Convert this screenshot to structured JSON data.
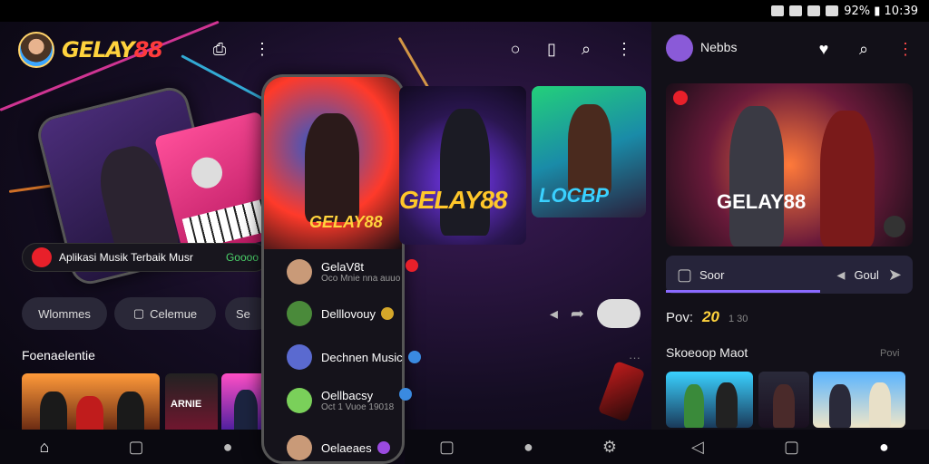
{
  "status_bar": {
    "text": "92% ▮ 10:39"
  },
  "left": {
    "logo_main": "GELAY",
    "logo_num": "88",
    "banner_tag": "Aplikasi Musik Terbaik Musr",
    "banner_action": "Goooo",
    "pills": [
      "Wlommes",
      "Celemue",
      "Se"
    ],
    "section_title": "Foenaelentie",
    "poster_text": "ARNIE"
  },
  "middle": {
    "phone_logo": "GELAY88",
    "big_logo": "GELAY88",
    "poster2_text": "LOCBP",
    "rows": [
      {
        "title": "GelaV8t",
        "sub": "Oco Mnie nna auuo"
      },
      {
        "title": "Delllovouy",
        "sub": ""
      },
      {
        "title": "Dechnen Music",
        "sub": ""
      },
      {
        "title": "Oellbacsy",
        "sub": "Oct 1 Vuoe 19018"
      },
      {
        "title": "Oelaeaes",
        "sub": ""
      }
    ]
  },
  "right": {
    "title": "Nebbs",
    "poster_logo": "GELAY88",
    "player_left": "Soor",
    "player_right": "Goul",
    "pov_label": "Pov:",
    "pov_value": "20",
    "pov_sub": "1 30",
    "section_title": "Skoeoop Maot",
    "section_action": "Povi"
  },
  "icons": {
    "share": "share-icon",
    "more": "more-icon",
    "search": "search-icon",
    "heart": "heart-icon",
    "home": "home-icon",
    "square": "square-icon",
    "profile": "profile-icon",
    "back": "back-icon"
  }
}
